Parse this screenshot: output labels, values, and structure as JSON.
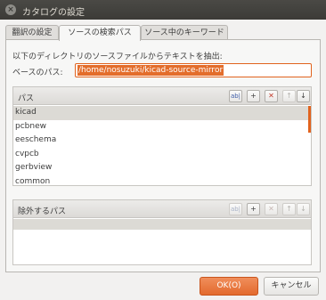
{
  "window": {
    "title": "カタログの設定"
  },
  "tabs": [
    {
      "label": "翻訳の設定"
    },
    {
      "label": "ソースの検索パス"
    },
    {
      "label": "ソース中のキーワード"
    }
  ],
  "source_paths": {
    "header": "以下のディレクトリのソースファイルからテキストを抽出:",
    "base_label": "ベースのパス:",
    "base_value": "/home/nosuzuki/kicad-source-mirror",
    "paths_label": "パス",
    "paths": [
      "kicad",
      "pcbnew",
      "eeschema",
      "cvpcb",
      "gerbview",
      "common"
    ],
    "excluded_label": "除外するパス",
    "excluded": [],
    "toolbar": {
      "edit": "ab|",
      "add": "+",
      "delete": "✕",
      "up": "↑",
      "down": "↓"
    }
  },
  "buttons": {
    "ok": "OK(O)",
    "cancel": "キャンセル"
  },
  "colors": {
    "accent": "#e36a2e",
    "titlebar": "#3c3b37"
  }
}
